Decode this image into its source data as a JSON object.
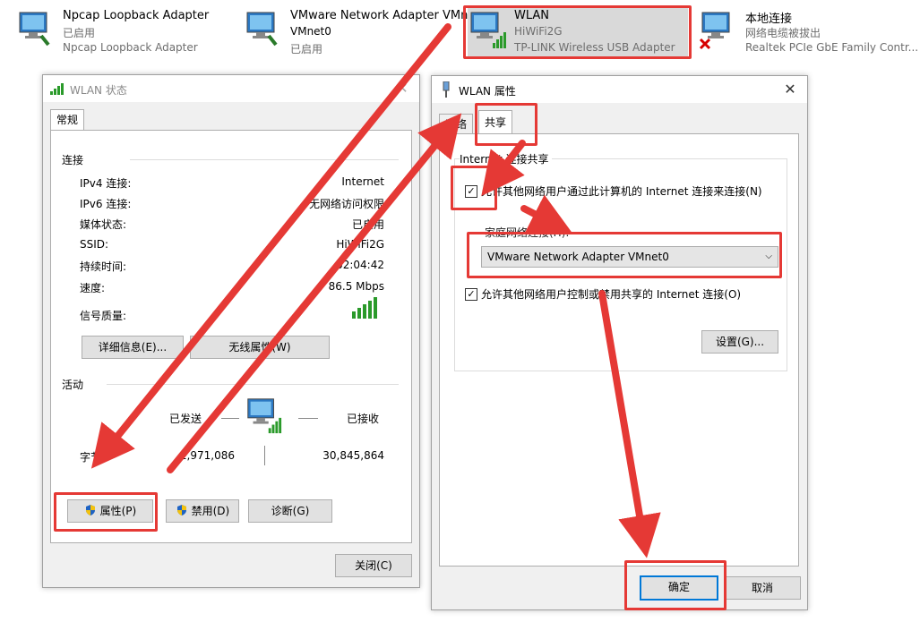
{
  "adapters": [
    {
      "name": "Npcap Loopback Adapter",
      "status": "已启用",
      "device": "Npcap Loopback Adapter"
    },
    {
      "name": "VMware Network Adapter VMnet0",
      "status": "VMnet0",
      "device": "已启用"
    },
    {
      "name": "WLAN",
      "status": "HiWiFi2G",
      "device": "TP-LINK Wireless USB Adapter"
    },
    {
      "name": "本地连接",
      "status": "网络电缆被拔出",
      "device": "Realtek PCIe GbE Family Contr..."
    }
  ],
  "status_dialog": {
    "title": "WLAN 状态",
    "tab": "常规",
    "connection_group": "连接",
    "rows": [
      {
        "label": "IPv4 连接:",
        "value": "Internet"
      },
      {
        "label": "IPv6 连接:",
        "value": "无网络访问权限"
      },
      {
        "label": "媒体状态:",
        "value": "已启用"
      },
      {
        "label": "SSID:",
        "value": "HiWiFi2G"
      },
      {
        "label": "持续时间:",
        "value": "02:04:42"
      },
      {
        "label": "速度:",
        "value": "86.5 Mbps"
      },
      {
        "label": "信号质量:",
        "value": ""
      }
    ],
    "details_button": "详细信息(E)...",
    "wireless_props_button": "无线属性(W)",
    "activity_group": "活动",
    "sent_label": "已发送",
    "received_label": "已接收",
    "bytes_label": "字节:",
    "bytes_sent": "1,971,086",
    "bytes_received": "30,845,864",
    "properties_button": "属性(P)",
    "disable_button": "禁用(D)",
    "diagnose_button": "诊断(G)",
    "close_button": "关闭(C)"
  },
  "props_dialog": {
    "title": "WLAN 属性",
    "tabs": [
      "网络",
      "共享"
    ],
    "group": "Internet 连接共享",
    "allow_share": "允许其他网络用户通过此计算机的 Internet 连接来连接(N)",
    "home_network_label": "家庭网络连接(H):",
    "home_network_value": "VMware Network Adapter VMnet0",
    "allow_control": "允许其他网络用户控制或禁用共享的 Internet 连接(O)",
    "settings_button": "设置(G)...",
    "ok_button": "确定",
    "cancel_button": "取消"
  },
  "colors": {
    "annotation": "#e53935",
    "accent": "#0078d7"
  }
}
